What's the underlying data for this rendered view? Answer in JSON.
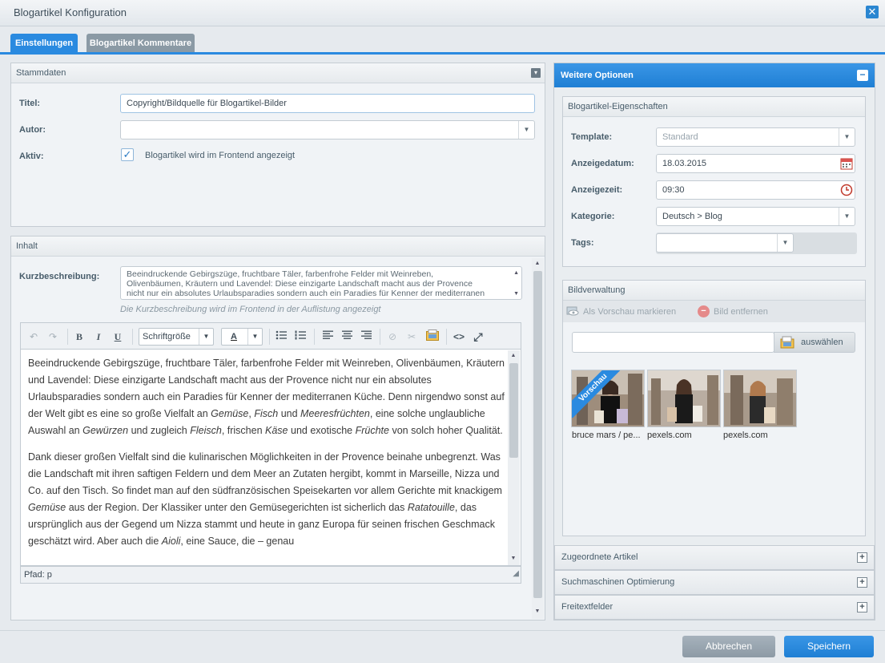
{
  "window": {
    "title": "Blogartikel Konfiguration"
  },
  "tabs": [
    {
      "label": "Einstellungen",
      "active": true
    },
    {
      "label": "Blogartikel Kommentare",
      "active": false
    }
  ],
  "stammdaten": {
    "header": "Stammdaten",
    "title_label": "Titel:",
    "title_value": "Copyright/Bildquelle für Blogartikel-Bilder",
    "author_label": "Autor:",
    "author_value": "",
    "active_label": "Aktiv:",
    "active_checked": true,
    "active_text": "Blogartikel wird im Frontend angezeigt"
  },
  "inhalt": {
    "header": "Inhalt",
    "short_desc_label": "Kurzbeschreibung:",
    "short_desc_lines": [
      "Beeindruckende Gebirgszüge, fruchtbare Täler, farbenfrohe Felder mit Weinreben,",
      "Olivenbäumen, Kräutern und Lavendel: Diese einzigarte Landschaft macht aus der Provence",
      "nicht nur ein absolutes Urlaubsparadies sondern auch ein Paradies für Kenner der mediterranen"
    ],
    "short_desc_hint": "Die Kurzbeschreibung wird im Frontend in der Auflistung angezeigt",
    "toolbar": {
      "undo": "↶",
      "redo": "↷",
      "bold": "B",
      "italic": "I",
      "underline": "U",
      "font_size": "Schriftgröße",
      "font_color": "A",
      "source": "<>",
      "fullscreen": "⤢"
    },
    "status_path": "Pfad: p"
  },
  "weitere_optionen": {
    "header": "Weitere Optionen",
    "eigenschaften": {
      "header": "Blogartikel-Eigenschaften",
      "template_label": "Template:",
      "template_value": "Standard",
      "date_label": "Anzeigedatum:",
      "date_value": "18.03.2015",
      "time_label": "Anzeigezeit:",
      "time_value": "09:30",
      "category_label": "Kategorie:",
      "category_value": "Deutsch > Blog",
      "tags_label": "Tags:",
      "tags_value": ""
    },
    "bildverwaltung": {
      "header": "Bildverwaltung",
      "mark_preview": "Als Vorschau markieren",
      "remove_image": "Bild entfernen",
      "select_button": "auswählen",
      "preview_ribbon": "Vorschau",
      "images": [
        {
          "label": "bruce mars / pe..."
        },
        {
          "label": "pexels.com"
        },
        {
          "label": "pexels.com"
        }
      ]
    },
    "collapsed_sections": [
      "Zugeordnete Artikel",
      "Suchmaschinen Optimierung",
      "Freitextfelder"
    ]
  },
  "footer": {
    "cancel": "Abbrechen",
    "save": "Speichern"
  },
  "colors": {
    "accent": "#2a8ae0",
    "cancel": "#95a2ad"
  }
}
